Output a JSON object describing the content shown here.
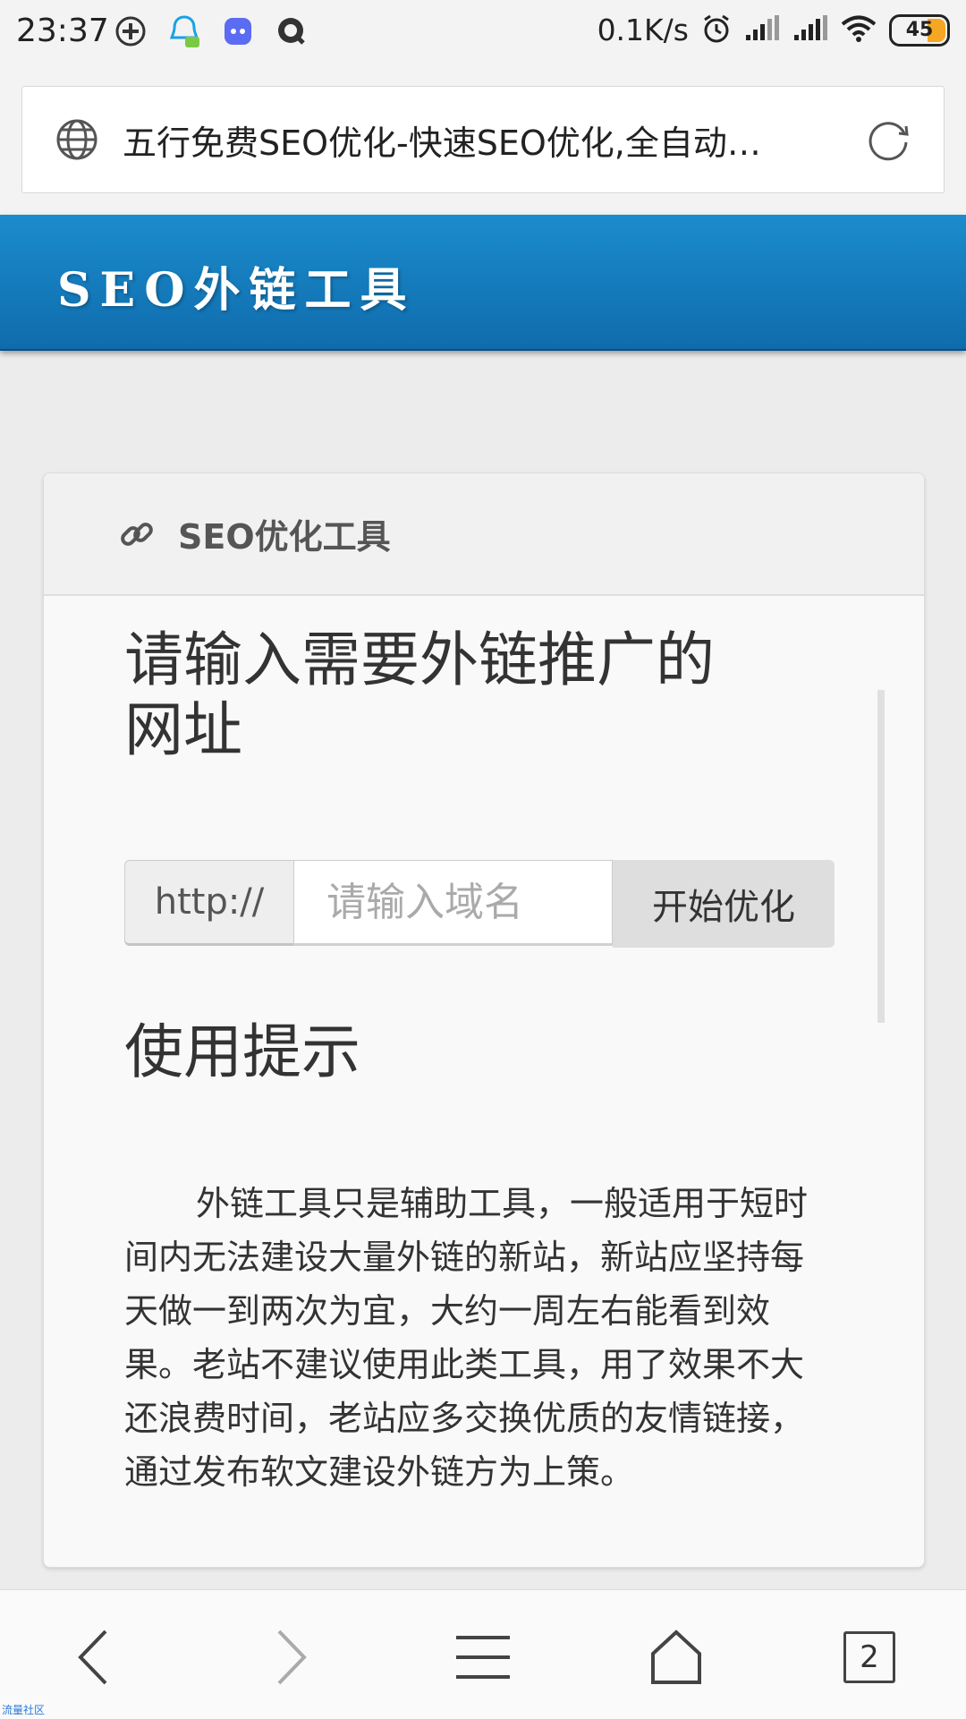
{
  "status_bar": {
    "time": "23:37",
    "net_speed": "0.1K/s",
    "battery": "45",
    "icons": [
      "plus-app-icon",
      "qq-chat-icon",
      "app-chat-icon",
      "search-bubble-icon",
      "alarm-icon",
      "signal-icon",
      "signal-icon",
      "wifi-icon"
    ]
  },
  "browser": {
    "page_title": "五行免费SEO优化-快速SEO优化,全自动…",
    "tab_count": "2"
  },
  "site": {
    "logo_text": "SEO外链工具"
  },
  "panel": {
    "title": "SEO优化工具",
    "heading": "请输入需要外链推广的网址",
    "input_prefix": "http://",
    "input_placeholder": "请输入域名",
    "submit_label": "开始优化",
    "tips_heading": "使用提示",
    "tips_text": "外链工具只是辅助工具，一般适用于短时间内无法建设大量外链的新站，新站应坚持每天做一到两次为宜，大约一周左右能看到效果。老站不建议使用此类工具，用了效果不大还浪费时间，老站应多交换优质的友情链接，通过发布软文建设外链方为上策。"
  },
  "watermark": "流量社区",
  "colors": {
    "header_blue": "#1b8ccd",
    "battery_orange": "#f5a623"
  }
}
